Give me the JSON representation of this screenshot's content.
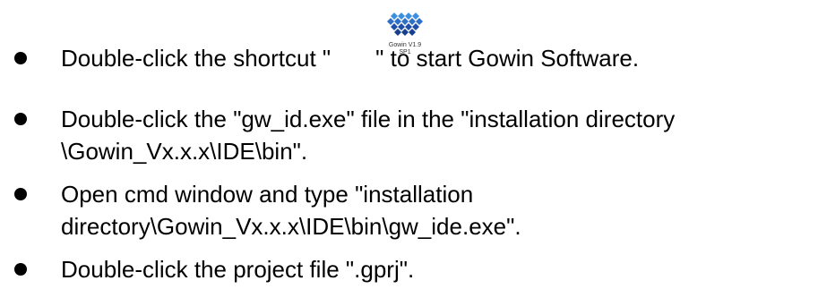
{
  "bullets": [
    {
      "lines": [
        {
          "before_icon": "Double-click the shortcut \"",
          "after_icon": "\" to start Gowin Software."
        }
      ],
      "icon": {
        "name": "gowin-shortcut-icon",
        "caption_line1": "Gowin V1.9",
        "caption_line2": "SP1"
      }
    },
    {
      "lines": [
        "Double-click the \"gw_id.exe\" file in the \"installation directory",
        "\\Gowin_Vx.x.x\\IDE\\bin\"."
      ]
    },
    {
      "lines": [
        "Open cmd window and type \"installation",
        "directory\\Gowin_Vx.x.x\\IDE\\bin\\gw_ide.exe\"."
      ]
    },
    {
      "lines": [
        "Double-click the project file \".gprj\"."
      ]
    }
  ],
  "colors": {
    "text": "#000000",
    "bullet": "#000000",
    "icon_blue": "#1f4fa8",
    "icon_light_blue": "#3c8fe0"
  }
}
